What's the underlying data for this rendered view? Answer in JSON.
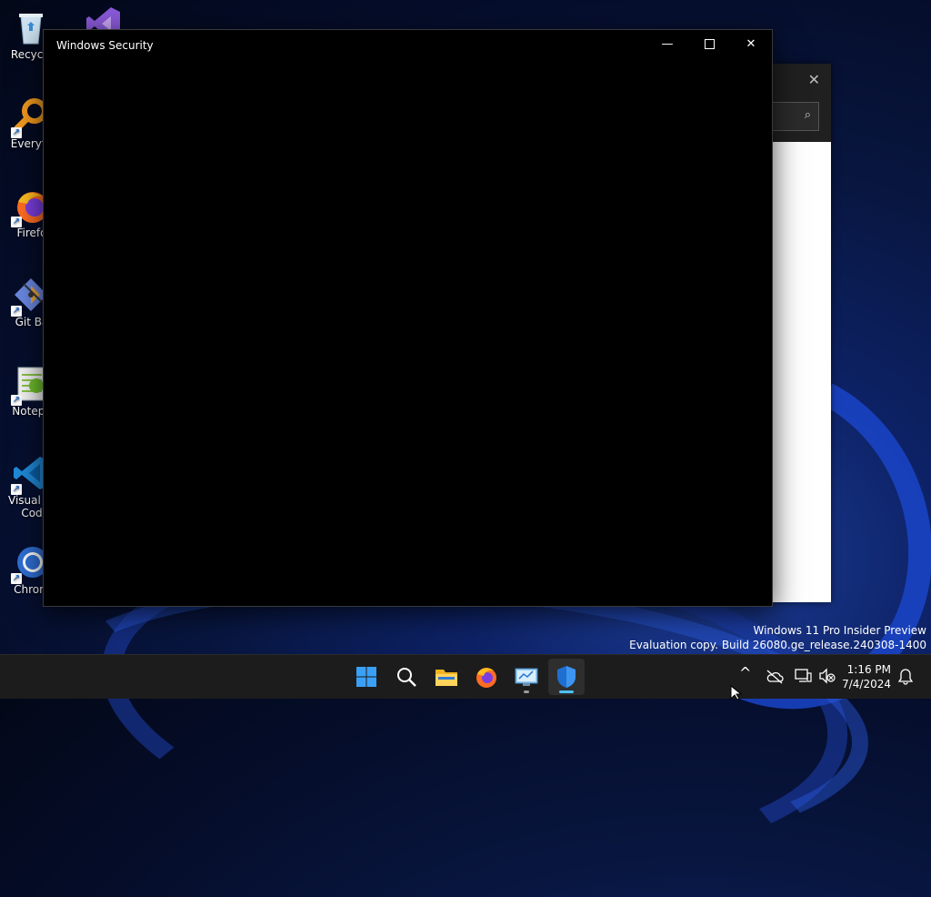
{
  "desktop": {
    "icons": [
      {
        "label": "Recycle",
        "icon": "recycle-bin-icon"
      },
      {
        "label": "",
        "icon": "visual-studio-icon"
      },
      {
        "label": "Everyth",
        "icon": "everything-search-icon"
      },
      {
        "label": "Firefo",
        "icon": "firefox-icon"
      },
      {
        "label": "Git Ba",
        "icon": "git-bash-icon"
      },
      {
        "label": "Notepa",
        "icon": "notepad-plus-plus-icon"
      },
      {
        "label": "Visual St\nCod",
        "icon": "vscode-icon"
      },
      {
        "label": "Chrom",
        "icon": "chrome-icon"
      }
    ]
  },
  "main_window": {
    "title": "Windows Security",
    "minimize_symbol": "—",
    "close_symbol": "✕"
  },
  "background_window": {
    "close_symbol": "✕",
    "search_icon": "⌕"
  },
  "watermark": {
    "line1": "Windows 11 Pro Insider Preview",
    "line2": "Evaluation copy. Build 26080.ge_release.240308-1400"
  },
  "taskbar": {
    "apps": [
      {
        "name": "start",
        "icon": "windows-logo-icon"
      },
      {
        "name": "search",
        "icon": "search-icon"
      },
      {
        "name": "file-explorer",
        "icon": "folder-icon"
      },
      {
        "name": "firefox",
        "icon": "firefox-icon"
      },
      {
        "name": "control-panel",
        "icon": "control-panel-icon"
      },
      {
        "name": "windows-security",
        "icon": "shield-icon"
      }
    ],
    "tray": {
      "chevron": "^",
      "time": "1:16 PM",
      "date": "7/4/2024"
    }
  },
  "colors": {
    "accent": "#4cc2ff",
    "taskbar": "#1c1c1c",
    "window_bg": "#000000"
  }
}
